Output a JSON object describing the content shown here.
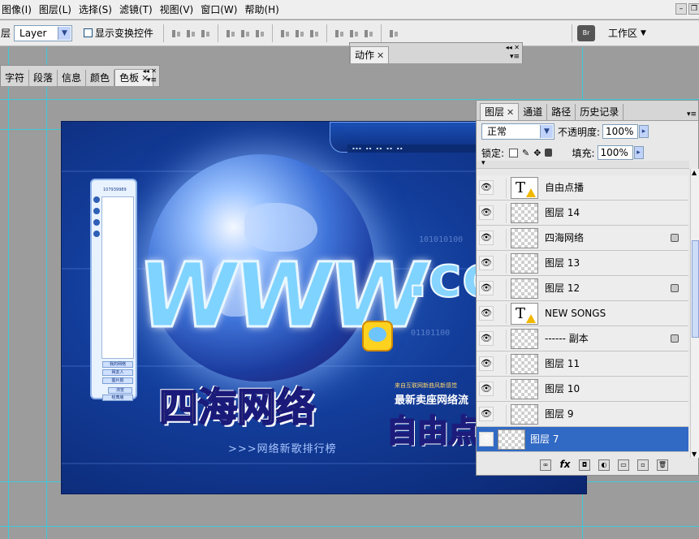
{
  "menu": [
    "图像(I)",
    "图层(L)",
    "选择(S)",
    "滤镜(T)",
    "视图(V)",
    "窗口(W)",
    "帮助(H)"
  ],
  "options_bar": {
    "layer_label": "层",
    "layer_select_value": "Layer",
    "show_transform_label": "显示变换控件",
    "workspace_label": "工作区"
  },
  "actions_palette": {
    "tab": "动作"
  },
  "left_palette": {
    "tabs": [
      "字符",
      "段落",
      "信息",
      "颜色",
      "色板"
    ]
  },
  "artwork": {
    "www_text": "WWW",
    "com_text": ".co",
    "logo_cn": "四海网络",
    "ziyou": "自由点",
    "slogan": "最新卖座网络流",
    "subline": "来自互联网新曲风新感觉",
    "tagline": ">>>网络新歌排行榜",
    "side_items": [
      "我的网络",
      "网友人",
      "图片报"
    ],
    "side_buttons": [
      "经典版",
      "浏览"
    ],
    "side_number": "107939989"
  },
  "layers_panel": {
    "tabs": [
      "图层",
      "通道",
      "路径",
      "历史记录"
    ],
    "blend_mode": "正常",
    "opacity_label": "不透明度:",
    "opacity_value": "100%",
    "lock_label": "锁定:",
    "fill_label": "填充:",
    "fill_value": "100%",
    "layers": [
      {
        "name": "自由点播",
        "type": "text",
        "locked": false,
        "selected": false
      },
      {
        "name": "图层 14",
        "type": "pixel",
        "locked": false,
        "selected": false
      },
      {
        "name": "四海网络",
        "type": "pixel",
        "locked": true,
        "selected": false
      },
      {
        "name": "图层 13",
        "type": "pixel",
        "locked": false,
        "selected": false
      },
      {
        "name": "图层 12",
        "type": "pixel",
        "locked": true,
        "selected": false
      },
      {
        "name": "NEW SONGS",
        "type": "text",
        "locked": false,
        "selected": false
      },
      {
        "name": "------ 副本",
        "type": "pixel",
        "locked": true,
        "selected": false
      },
      {
        "name": "图层 11",
        "type": "pixel",
        "locked": false,
        "selected": false
      },
      {
        "name": "图层 10",
        "type": "pixel",
        "locked": false,
        "selected": false
      },
      {
        "name": "图层 9",
        "type": "pixel",
        "locked": false,
        "selected": false
      },
      {
        "name": "图层 7",
        "type": "pixel",
        "locked": false,
        "selected": true
      }
    ]
  },
  "colors": {
    "accent": "#316ac5",
    "guide": "#3ec9d9",
    "canvas_bg": "#9c9c9c"
  }
}
